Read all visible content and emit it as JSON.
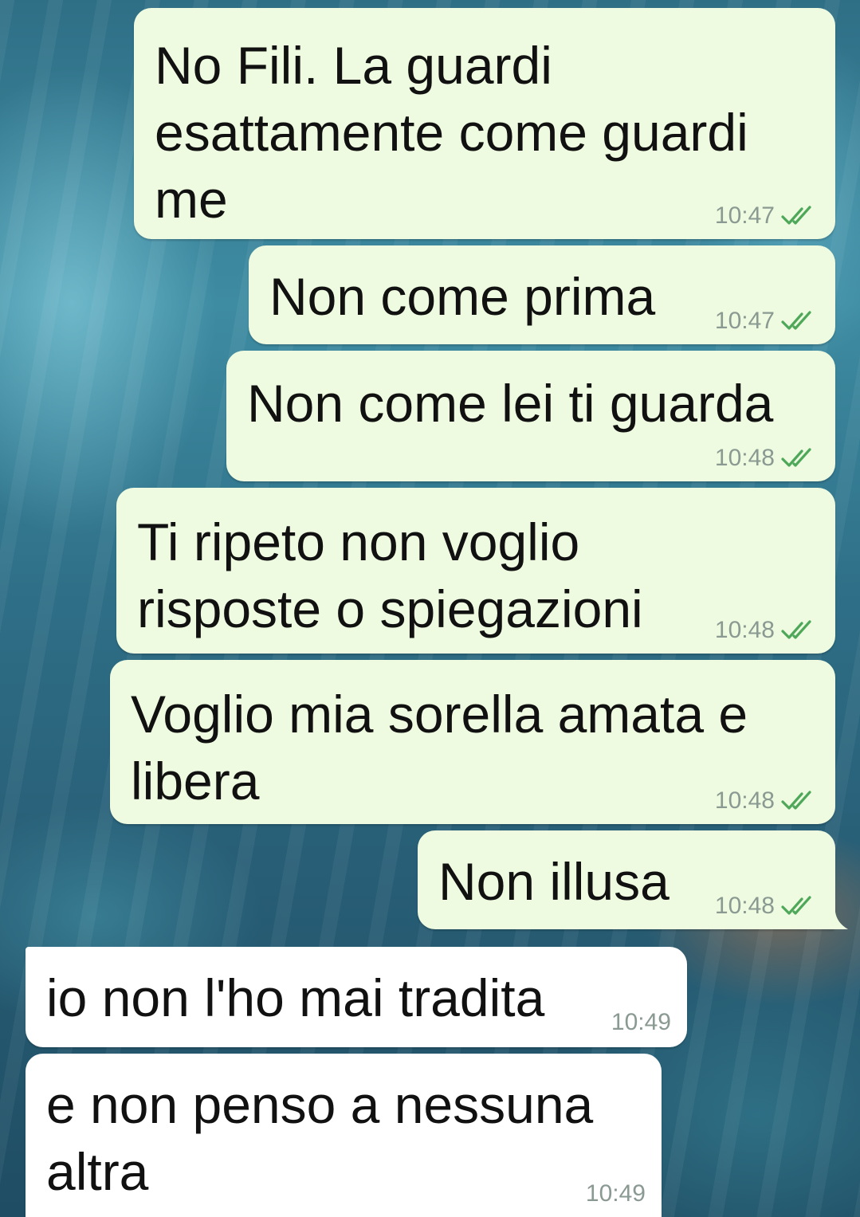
{
  "messages": [
    {
      "direction": "outgoing",
      "text": "No Fili. La guardi\nesattamente come guardi\nme",
      "time": "10:47",
      "status_icon": "double-check-read-icon"
    },
    {
      "direction": "outgoing",
      "text": "Non come prima",
      "time": "10:47",
      "status_icon": "double-check-read-icon"
    },
    {
      "direction": "outgoing",
      "text": "Non come lei ti guarda",
      "time": "10:48",
      "status_icon": "double-check-read-icon"
    },
    {
      "direction": "outgoing",
      "text": "Ti ripeto non voglio\nrisposte o spiegazioni",
      "time": "10:48",
      "status_icon": "double-check-read-icon"
    },
    {
      "direction": "outgoing",
      "text": "Voglio mia sorella amata e\nlibera",
      "time": "10:48",
      "status_icon": "double-check-read-icon"
    },
    {
      "direction": "outgoing",
      "text": "Non illusa",
      "time": "10:48",
      "status_icon": "double-check-read-icon"
    },
    {
      "direction": "incoming",
      "text": "io non l'ho mai tradita",
      "time": "10:49"
    },
    {
      "direction": "incoming",
      "text": "e non penso a nessuna\naltra",
      "time": "10:49"
    }
  ],
  "colors": {
    "outgoing_bubble": "#eefbe0",
    "incoming_bubble": "#ffffff",
    "read_tick": "#4fa85a",
    "timestamp": "#8a9a92",
    "wallpaper_base": "#2f6f86"
  }
}
